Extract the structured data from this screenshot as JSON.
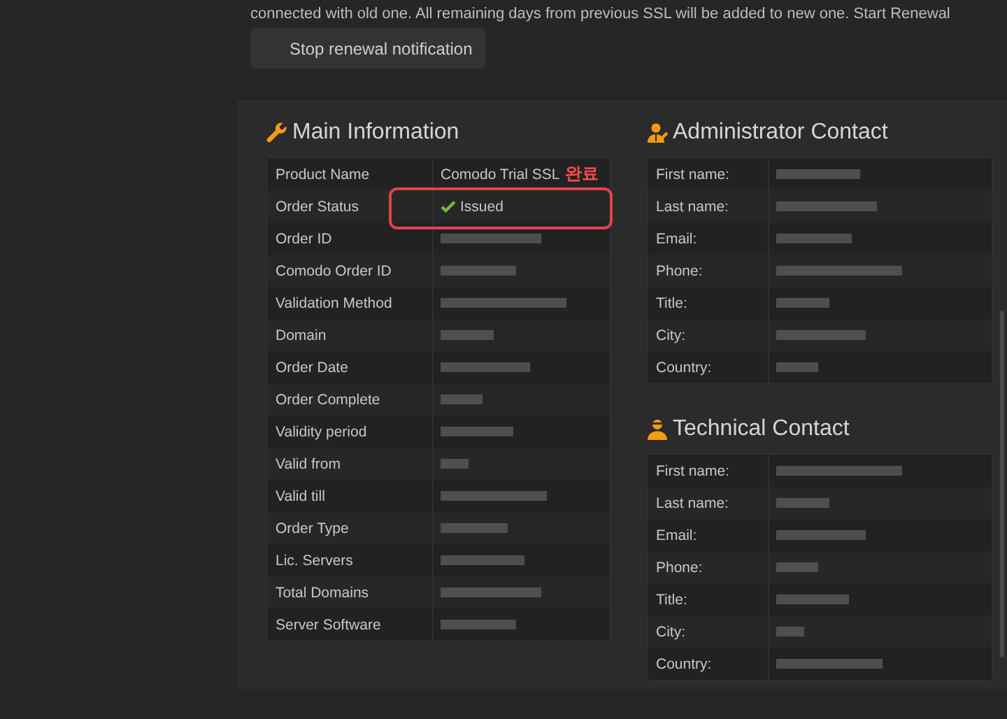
{
  "notice": "connected with old one. All remaining days from previous SSL will be added to new one. Start Renewal",
  "stop_button": "Stop renewal notification",
  "main": {
    "title": "Main Information",
    "annotation": "완료",
    "rows": [
      {
        "label": "Product Name",
        "kind": "text",
        "value": "Comodo Trial SSL"
      },
      {
        "label": "Order Status",
        "kind": "status",
        "value": "Issued"
      },
      {
        "label": "Order ID",
        "kind": "redacted"
      },
      {
        "label": "Comodo Order ID",
        "kind": "redacted"
      },
      {
        "label": "Validation Method",
        "kind": "redacted"
      },
      {
        "label": "Domain",
        "kind": "redacted"
      },
      {
        "label": "Order Date",
        "kind": "redacted"
      },
      {
        "label": "Order Complete",
        "kind": "redacted"
      },
      {
        "label": "Validity period",
        "kind": "redacted"
      },
      {
        "label": "Valid from",
        "kind": "redacted"
      },
      {
        "label": "Valid till",
        "kind": "redacted"
      },
      {
        "label": "Order Type",
        "kind": "redacted"
      },
      {
        "label": "Lic. Servers",
        "kind": "redacted"
      },
      {
        "label": "Total Domains",
        "kind": "redacted"
      },
      {
        "label": "Server Software",
        "kind": "redacted"
      }
    ]
  },
  "contacts": [
    {
      "title": "Administrator Contact",
      "kind": "admin",
      "rows": [
        "First name:",
        "Last name:",
        "Email:",
        "Phone:",
        "Title:",
        "City:",
        "Country:"
      ]
    },
    {
      "title": "Technical Contact",
      "kind": "tech",
      "rows": [
        "First name:",
        "Last name:",
        "Email:",
        "Phone:",
        "Title:",
        "City:",
        "Country:"
      ]
    }
  ]
}
